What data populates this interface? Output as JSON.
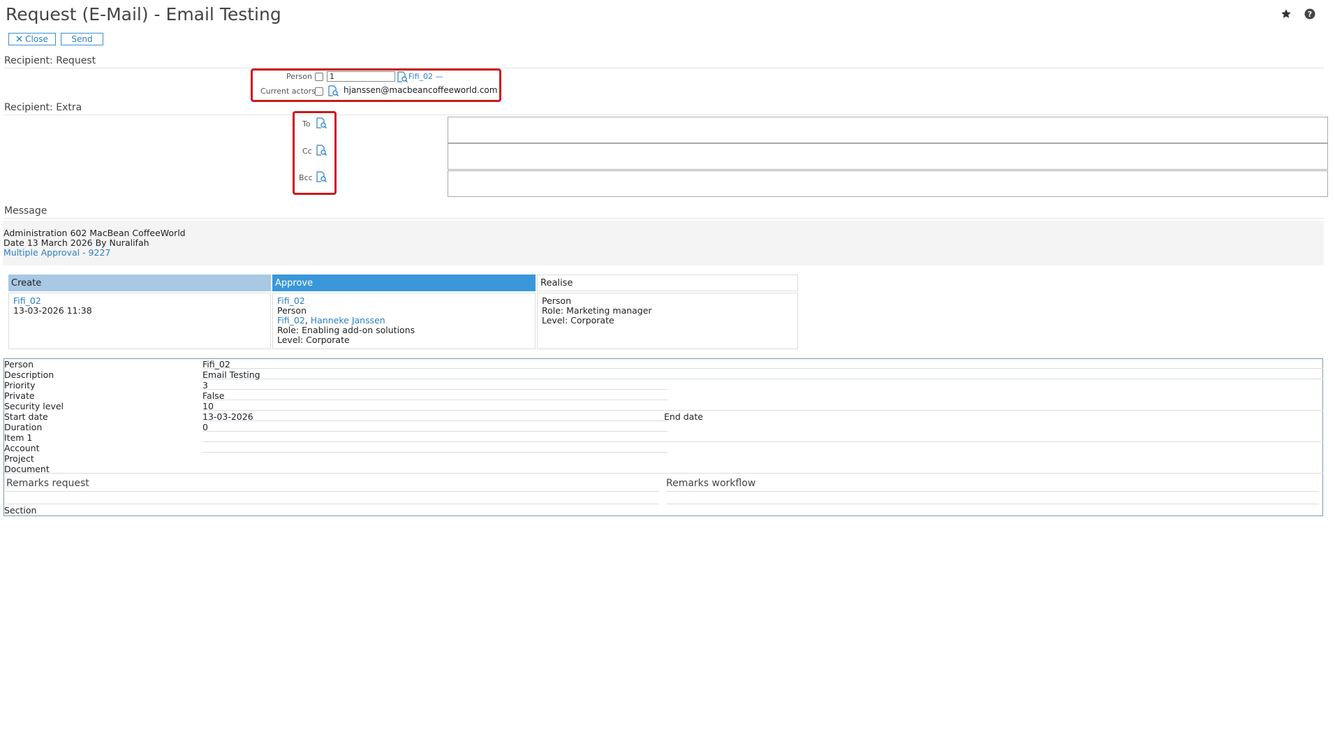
{
  "header": {
    "title": "Request (E-Mail) - Email Testing",
    "close_label": "Close",
    "send_label": "Send",
    "star_icon": "star-icon",
    "help_icon": "help-icon"
  },
  "recipient_request": {
    "section_title": "Recipient: Request",
    "person_label": "Person",
    "person_value": "1",
    "person_link": "Fifi_02 —",
    "current_actors_label": "Current actors",
    "current_actors_email": "hjanssen@macbeancoffeeworld.com"
  },
  "recipient_extra": {
    "section_title": "Recipient: Extra",
    "to_label": "To",
    "cc_label": "Cc",
    "bcc_label": "Bcc"
  },
  "message": {
    "section_title": "Message",
    "line1": "Administration 602 MacBean CoffeeWorld",
    "line2": "Date 13 March 2026 By Nuralifah",
    "link": "Multiple Approval - 9227"
  },
  "workflow": {
    "columns": [
      "Create",
      "Approve",
      "Realise"
    ],
    "create": {
      "person_link": "Fifi_02",
      "datetime": "13-03-2026 11:38"
    },
    "approve": {
      "person_link": "Fifi_02",
      "type": "Person",
      "actor_link1": "Fifi_02",
      "separator": ",",
      "actor_link2": "Hanneke Janssen",
      "role": "Role: Enabling add-on solutions",
      "level": "Level: Corporate"
    },
    "realise": {
      "type": "Person",
      "role": "Role: Marketing manager",
      "level": "Level: Corporate"
    }
  },
  "properties": {
    "rows": [
      {
        "label": "Person",
        "value": "Fifi_02"
      },
      {
        "label": "Description",
        "value": "Email Testing"
      },
      {
        "label": "Priority",
        "value": "3"
      },
      {
        "label": "Private",
        "value": "False"
      },
      {
        "label": "Security level",
        "value": "10"
      },
      {
        "label": "Start date",
        "value": "13-03-2026"
      },
      {
        "label": "Duration",
        "value": "0"
      },
      {
        "label": "Item 1",
        "value": ""
      },
      {
        "label": "Account",
        "value": ""
      },
      {
        "label": "Project",
        "value": ""
      },
      {
        "label": "Document",
        "value": ""
      }
    ],
    "end_date_label": "End date",
    "remarks_request": "Remarks request",
    "remarks_workflow": "Remarks workflow",
    "section_label": "Section"
  },
  "colors": {
    "accent": "#2a7fc4",
    "create_header": "#a8c8e4",
    "approve_header": "#3a97da",
    "highlight_box": "#cc1a1a"
  }
}
